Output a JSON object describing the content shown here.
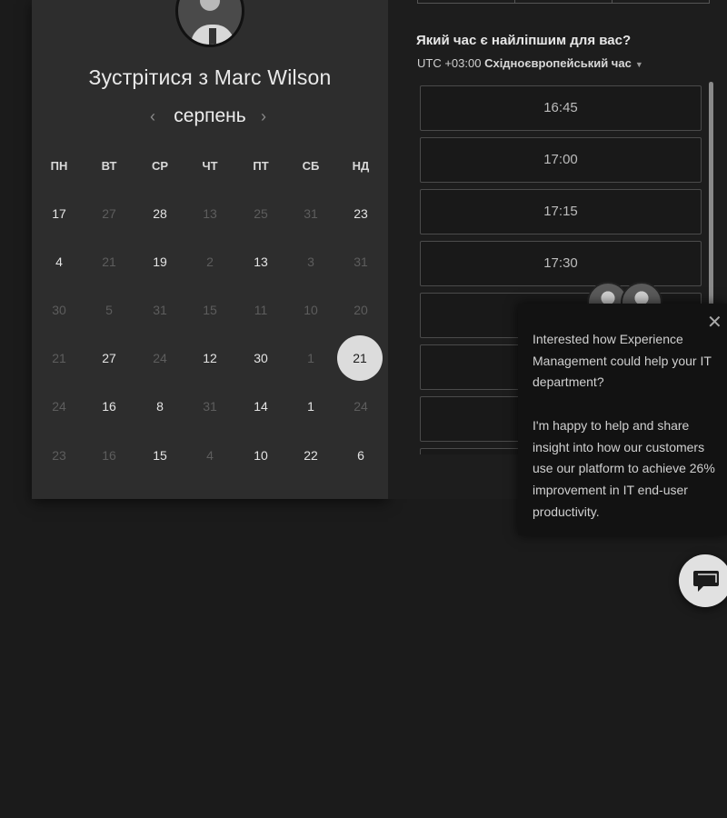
{
  "scheduler": {
    "title": "Зустрітися з Marc Wilson",
    "month": "серпень",
    "weekdays": [
      "ПН",
      "ВТ",
      "СР",
      "ЧТ",
      "ПТ",
      "СБ",
      "НД"
    ],
    "weeks": [
      [
        "17",
        "27",
        "28",
        "13",
        "25",
        "31",
        "23"
      ],
      [
        "4",
        "21",
        "19",
        "2",
        "13",
        "3",
        "31"
      ],
      [
        "30",
        "5",
        "31",
        "15",
        "11",
        "10",
        "20"
      ],
      [
        "21",
        "27",
        "24",
        "12",
        "30",
        "1",
        "21"
      ],
      [
        "24",
        "16",
        "8",
        "31",
        "14",
        "1",
        "24"
      ],
      [
        "23",
        "16",
        "15",
        "4",
        "10",
        "22",
        "6"
      ]
    ],
    "selected_day": "21"
  },
  "times": {
    "question": "Який час є найліпшим для вас?",
    "tz_prefix": "UTC +03:00 ",
    "tz_name": "Східноєвропейський час",
    "slots": [
      "16:45",
      "17:00",
      "17:15",
      "17:30",
      "",
      "",
      "",
      ""
    ]
  },
  "chat_popup": {
    "message": "Interested how Experience Management could help your IT department?\n\nI'm happy to help and share insight into how our customers use our platform to achieve 26% improvement in IT end-user productivity."
  },
  "icons": {
    "prev": "chevron-left-icon",
    "next": "chevron-right-icon",
    "close": "close-icon",
    "chat": "chat-bubble-icon",
    "tz_dropdown": "caret-down-icon"
  }
}
